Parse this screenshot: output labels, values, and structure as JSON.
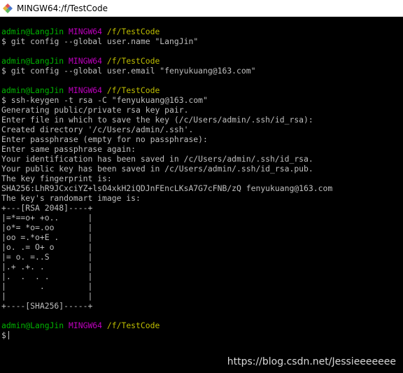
{
  "window": {
    "title": "MINGW64:/f/TestCode",
    "icon": "git-bash-diamond-icon",
    "icon_colors": {
      "top": "#e25555",
      "left": "#e8b33a",
      "right": "#4a78d0",
      "bottom": "#5cb85c"
    }
  },
  "colors": {
    "background": "#000000",
    "text": "#bfbfbf",
    "user_host": "#00b400",
    "mingw": "#bf00bf",
    "path": "#bfbf00"
  },
  "prompt": {
    "user_host": "admin@LangJin",
    "system": "MINGW64",
    "path": "/f/TestCode",
    "symbol": "$"
  },
  "commands": [
    {
      "command": "git config --global user.name \"LangJin\"",
      "output": []
    },
    {
      "command": "git config --global user.email \"fenyukuang@163.com\"",
      "output": []
    },
    {
      "command": "ssh-keygen -t rsa -C \"fenyukuang@163.com\"",
      "output": [
        "Generating public/private rsa key pair.",
        "Enter file in which to save the key (/c/Users/admin/.ssh/id_rsa):",
        "Created directory '/c/Users/admin/.ssh'.",
        "Enter passphrase (empty for no passphrase):",
        "Enter same passphrase again:",
        "Your identification has been saved in /c/Users/admin/.ssh/id_rsa.",
        "Your public key has been saved in /c/Users/admin/.ssh/id_rsa.pub.",
        "The key fingerprint is:",
        "SHA256:LhR9JCxciYZ+lsO4xkH2iQDJnFEncLKsA7G7cFNB/zQ fenyukuang@163.com",
        "The key's randomart image is:",
        "+---[RSA 2048]----+",
        "|=*==o+ +o..      |",
        "|o*= *o=.oo       |",
        "|oo =.*o+E .      |",
        "|o. .= O+ o       |",
        "|= o. =..S        |",
        "|.+ .+. .         |",
        "|.  .  . .        |",
        "|       .         |",
        "|                 |",
        "+----[SHA256]-----+"
      ]
    }
  ],
  "current_input": "",
  "watermark": "https://blog.csdn.net/Jessieeeeeee"
}
